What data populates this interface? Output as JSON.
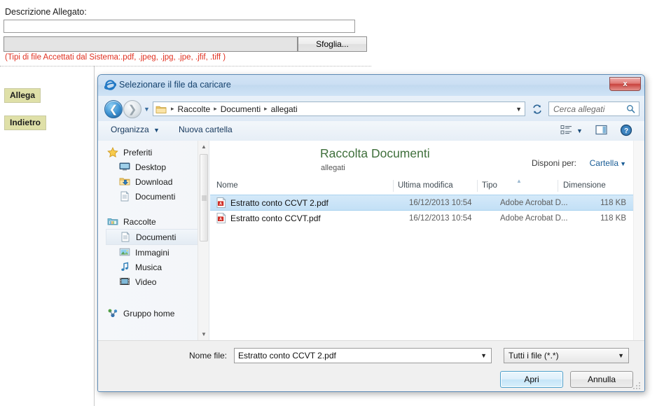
{
  "webpage": {
    "description_label": "Descrizione Allegato:",
    "description_value": "",
    "description_placeholder": "",
    "file_path_value": "",
    "browse_button": "Sfoglia...",
    "accepted_types_hint": "(Tipi di file Accettati dal Sistema:.pdf, .jpeg, .jpg, .jpe, .jfif, .tiff )",
    "attach_button": "Allega",
    "back_button": "Indietro",
    "button_bg_color": "#dfe0a8",
    "hint_color": "#e03020"
  },
  "dialog": {
    "title": "Selezionare il file da caricare",
    "title_icon": "internet-explorer-icon",
    "close_label": "x",
    "close_color": "#c9433e",
    "navigation": {
      "back_icon": "back-arrow-icon",
      "forward_icon": "forward-arrow-icon",
      "history_icon": "chevron-down-icon",
      "refresh_icon": "refresh-icon",
      "breadcrumbs": [
        "Raccolte",
        "Documenti",
        "allegati"
      ],
      "folder_icon": "folder-icon",
      "address_dropdown_icon": "chevron-down-icon",
      "search_placeholder": "Cerca allegati",
      "search_icon": "search-icon"
    },
    "toolbar": {
      "organize": "Organizza",
      "new_folder": "Nuova cartella",
      "view_icon": "view-list-icon",
      "preview_icon": "preview-pane-icon",
      "help_icon": "help-icon"
    },
    "nav_pane": {
      "groups": [
        {
          "root": {
            "label": "Preferiti",
            "icon": "star-icon",
            "selected": false
          },
          "children": [
            {
              "label": "Desktop",
              "icon": "desktop-icon",
              "selected": false
            },
            {
              "label": "Download",
              "icon": "download-folder-icon",
              "selected": false
            },
            {
              "label": "Documenti",
              "icon": "document-icon",
              "selected": false
            }
          ]
        },
        {
          "root": {
            "label": "Raccolte",
            "icon": "libraries-icon",
            "selected": false
          },
          "children": [
            {
              "label": "Documenti",
              "icon": "document-icon",
              "selected": true
            },
            {
              "label": "Immagini",
              "icon": "pictures-icon",
              "selected": false
            },
            {
              "label": "Musica",
              "icon": "music-icon",
              "selected": false
            },
            {
              "label": "Video",
              "icon": "video-icon",
              "selected": false
            }
          ]
        },
        {
          "root": {
            "label": "Gruppo home",
            "icon": "homegroup-icon",
            "selected": false
          },
          "children": []
        }
      ]
    },
    "library": {
      "title": "Raccolta Documenti",
      "subtitle": "allegati",
      "arrange_label": "Disponi per:",
      "arrange_value": "Cartella",
      "arrange_caret_icon": "chevron-down-icon",
      "title_color": "#3f6f3b"
    },
    "file_list": {
      "columns": [
        "Nome",
        "Ultima modifica",
        "Tipo",
        "Dimensione"
      ],
      "sort_indicator_icon": "sort-ascending-icon",
      "rows": [
        {
          "icon": "pdf-file-icon",
          "name": "Estratto conto CCVT 2.pdf",
          "modified": "16/12/2013 10:54",
          "type": "Adobe Acrobat D...",
          "size": "118 KB",
          "selected": true
        },
        {
          "icon": "pdf-file-icon",
          "name": "Estratto conto CCVT.pdf",
          "modified": "16/12/2013 10:54",
          "type": "Adobe Acrobat D...",
          "size": "118 KB",
          "selected": false
        }
      ]
    },
    "footer": {
      "filename_label": "Nome file:",
      "filename_value": "Estratto conto CCVT 2.pdf",
      "filename_caret_icon": "chevron-down-icon",
      "filter_value": "Tutti i file (*.*)",
      "filter_caret_icon": "chevron-down-icon",
      "open_button": "Apri",
      "cancel_button": "Annulla"
    }
  }
}
